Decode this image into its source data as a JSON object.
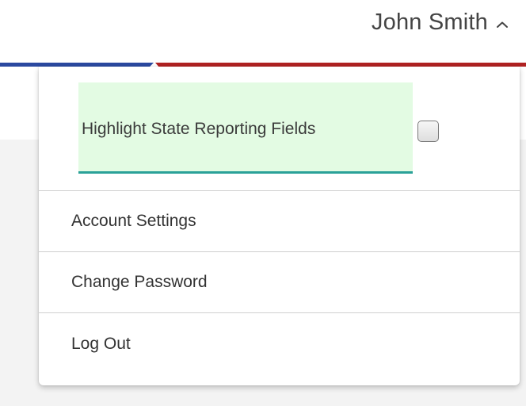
{
  "header": {
    "user_name": "John Smith",
    "user_menu_icon": "chevron-up-icon"
  },
  "dropdown": {
    "highlight": {
      "label": "Highlight State Reporting Fields",
      "checked": false
    },
    "items": [
      {
        "label": "Account Settings"
      },
      {
        "label": "Change Password"
      },
      {
        "label": "Log Out"
      }
    ]
  },
  "colors": {
    "stripe_blue": "#2b49a0",
    "stripe_red": "#b02222",
    "highlight_bg": "#e3fbe3",
    "highlight_underline": "#2aa198"
  }
}
